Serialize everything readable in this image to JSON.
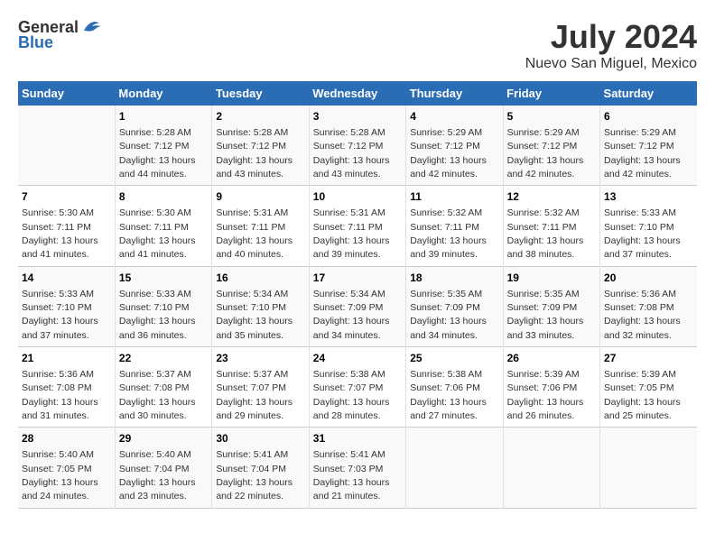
{
  "logo": {
    "general": "General",
    "blue": "Blue"
  },
  "title": "July 2024",
  "subtitle": "Nuevo San Miguel, Mexico",
  "days": [
    "Sunday",
    "Monday",
    "Tuesday",
    "Wednesday",
    "Thursday",
    "Friday",
    "Saturday"
  ],
  "weeks": [
    [
      {
        "num": "",
        "sunrise": "",
        "sunset": "",
        "daylight": ""
      },
      {
        "num": "1",
        "sunrise": "Sunrise: 5:28 AM",
        "sunset": "Sunset: 7:12 PM",
        "daylight": "Daylight: 13 hours and 44 minutes."
      },
      {
        "num": "2",
        "sunrise": "Sunrise: 5:28 AM",
        "sunset": "Sunset: 7:12 PM",
        "daylight": "Daylight: 13 hours and 43 minutes."
      },
      {
        "num": "3",
        "sunrise": "Sunrise: 5:28 AM",
        "sunset": "Sunset: 7:12 PM",
        "daylight": "Daylight: 13 hours and 43 minutes."
      },
      {
        "num": "4",
        "sunrise": "Sunrise: 5:29 AM",
        "sunset": "Sunset: 7:12 PM",
        "daylight": "Daylight: 13 hours and 42 minutes."
      },
      {
        "num": "5",
        "sunrise": "Sunrise: 5:29 AM",
        "sunset": "Sunset: 7:12 PM",
        "daylight": "Daylight: 13 hours and 42 minutes."
      },
      {
        "num": "6",
        "sunrise": "Sunrise: 5:29 AM",
        "sunset": "Sunset: 7:12 PM",
        "daylight": "Daylight: 13 hours and 42 minutes."
      }
    ],
    [
      {
        "num": "7",
        "sunrise": "Sunrise: 5:30 AM",
        "sunset": "Sunset: 7:11 PM",
        "daylight": "Daylight: 13 hours and 41 minutes."
      },
      {
        "num": "8",
        "sunrise": "Sunrise: 5:30 AM",
        "sunset": "Sunset: 7:11 PM",
        "daylight": "Daylight: 13 hours and 41 minutes."
      },
      {
        "num": "9",
        "sunrise": "Sunrise: 5:31 AM",
        "sunset": "Sunset: 7:11 PM",
        "daylight": "Daylight: 13 hours and 40 minutes."
      },
      {
        "num": "10",
        "sunrise": "Sunrise: 5:31 AM",
        "sunset": "Sunset: 7:11 PM",
        "daylight": "Daylight: 13 hours and 39 minutes."
      },
      {
        "num": "11",
        "sunrise": "Sunrise: 5:32 AM",
        "sunset": "Sunset: 7:11 PM",
        "daylight": "Daylight: 13 hours and 39 minutes."
      },
      {
        "num": "12",
        "sunrise": "Sunrise: 5:32 AM",
        "sunset": "Sunset: 7:11 PM",
        "daylight": "Daylight: 13 hours and 38 minutes."
      },
      {
        "num": "13",
        "sunrise": "Sunrise: 5:33 AM",
        "sunset": "Sunset: 7:10 PM",
        "daylight": "Daylight: 13 hours and 37 minutes."
      }
    ],
    [
      {
        "num": "14",
        "sunrise": "Sunrise: 5:33 AM",
        "sunset": "Sunset: 7:10 PM",
        "daylight": "Daylight: 13 hours and 37 minutes."
      },
      {
        "num": "15",
        "sunrise": "Sunrise: 5:33 AM",
        "sunset": "Sunset: 7:10 PM",
        "daylight": "Daylight: 13 hours and 36 minutes."
      },
      {
        "num": "16",
        "sunrise": "Sunrise: 5:34 AM",
        "sunset": "Sunset: 7:10 PM",
        "daylight": "Daylight: 13 hours and 35 minutes."
      },
      {
        "num": "17",
        "sunrise": "Sunrise: 5:34 AM",
        "sunset": "Sunset: 7:09 PM",
        "daylight": "Daylight: 13 hours and 34 minutes."
      },
      {
        "num": "18",
        "sunrise": "Sunrise: 5:35 AM",
        "sunset": "Sunset: 7:09 PM",
        "daylight": "Daylight: 13 hours and 34 minutes."
      },
      {
        "num": "19",
        "sunrise": "Sunrise: 5:35 AM",
        "sunset": "Sunset: 7:09 PM",
        "daylight": "Daylight: 13 hours and 33 minutes."
      },
      {
        "num": "20",
        "sunrise": "Sunrise: 5:36 AM",
        "sunset": "Sunset: 7:08 PM",
        "daylight": "Daylight: 13 hours and 32 minutes."
      }
    ],
    [
      {
        "num": "21",
        "sunrise": "Sunrise: 5:36 AM",
        "sunset": "Sunset: 7:08 PM",
        "daylight": "Daylight: 13 hours and 31 minutes."
      },
      {
        "num": "22",
        "sunrise": "Sunrise: 5:37 AM",
        "sunset": "Sunset: 7:08 PM",
        "daylight": "Daylight: 13 hours and 30 minutes."
      },
      {
        "num": "23",
        "sunrise": "Sunrise: 5:37 AM",
        "sunset": "Sunset: 7:07 PM",
        "daylight": "Daylight: 13 hours and 29 minutes."
      },
      {
        "num": "24",
        "sunrise": "Sunrise: 5:38 AM",
        "sunset": "Sunset: 7:07 PM",
        "daylight": "Daylight: 13 hours and 28 minutes."
      },
      {
        "num": "25",
        "sunrise": "Sunrise: 5:38 AM",
        "sunset": "Sunset: 7:06 PM",
        "daylight": "Daylight: 13 hours and 27 minutes."
      },
      {
        "num": "26",
        "sunrise": "Sunrise: 5:39 AM",
        "sunset": "Sunset: 7:06 PM",
        "daylight": "Daylight: 13 hours and 26 minutes."
      },
      {
        "num": "27",
        "sunrise": "Sunrise: 5:39 AM",
        "sunset": "Sunset: 7:05 PM",
        "daylight": "Daylight: 13 hours and 25 minutes."
      }
    ],
    [
      {
        "num": "28",
        "sunrise": "Sunrise: 5:40 AM",
        "sunset": "Sunset: 7:05 PM",
        "daylight": "Daylight: 13 hours and 24 minutes."
      },
      {
        "num": "29",
        "sunrise": "Sunrise: 5:40 AM",
        "sunset": "Sunset: 7:04 PM",
        "daylight": "Daylight: 13 hours and 23 minutes."
      },
      {
        "num": "30",
        "sunrise": "Sunrise: 5:41 AM",
        "sunset": "Sunset: 7:04 PM",
        "daylight": "Daylight: 13 hours and 22 minutes."
      },
      {
        "num": "31",
        "sunrise": "Sunrise: 5:41 AM",
        "sunset": "Sunset: 7:03 PM",
        "daylight": "Daylight: 13 hours and 21 minutes."
      },
      {
        "num": "",
        "sunrise": "",
        "sunset": "",
        "daylight": ""
      },
      {
        "num": "",
        "sunrise": "",
        "sunset": "",
        "daylight": ""
      },
      {
        "num": "",
        "sunrise": "",
        "sunset": "",
        "daylight": ""
      }
    ]
  ]
}
